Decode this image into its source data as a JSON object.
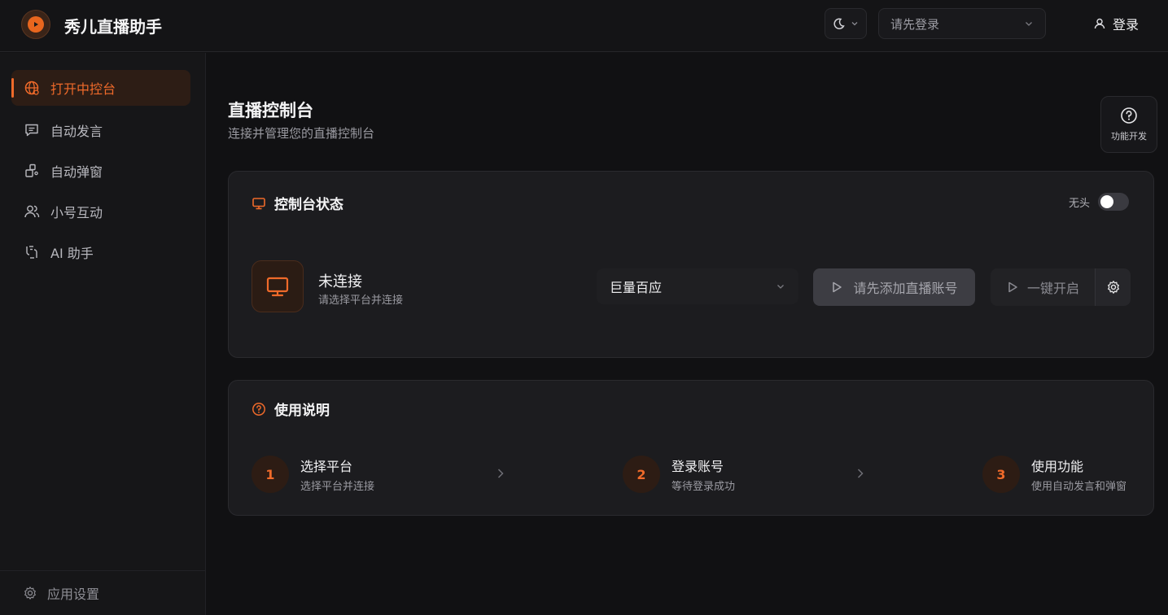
{
  "app": {
    "title": "秀儿直播助手"
  },
  "header": {
    "account_select": "请先登录",
    "login_label": "登录"
  },
  "sidebar": {
    "items": [
      {
        "label": "打开中控台",
        "icon": "globe-icon",
        "active": true
      },
      {
        "label": "自动发言",
        "icon": "message-icon",
        "active": false
      },
      {
        "label": "自动弹窗",
        "icon": "popup-icon",
        "active": false
      },
      {
        "label": "小号互动",
        "icon": "users-icon",
        "active": false
      },
      {
        "label": "AI 助手",
        "icon": "ai-icon",
        "active": false
      }
    ],
    "footer_label": "应用设置"
  },
  "main": {
    "title": "直播控制台",
    "subtitle": "连接并管理您的直播控制台",
    "dev_button_label": "功能开发",
    "status_card": {
      "title": "控制台状态",
      "headless_label": "无头",
      "headless_on": false,
      "status": "未连接",
      "status_sub": "请选择平台并连接",
      "platform": "巨量百应",
      "add_account_label": "请先添加直播账号",
      "one_key_label": "一键开启"
    },
    "guide_card": {
      "title": "使用说明",
      "steps": [
        {
          "num": "1",
          "title": "选择平台",
          "sub": "选择平台并连接"
        },
        {
          "num": "2",
          "title": "登录账号",
          "sub": "等待登录成功"
        },
        {
          "num": "3",
          "title": "使用功能",
          "sub": "使用自动发言和弹窗"
        }
      ]
    }
  },
  "colors": {
    "accent": "#ef6a2a",
    "background": "#111113",
    "card": "#1c1c1f"
  }
}
